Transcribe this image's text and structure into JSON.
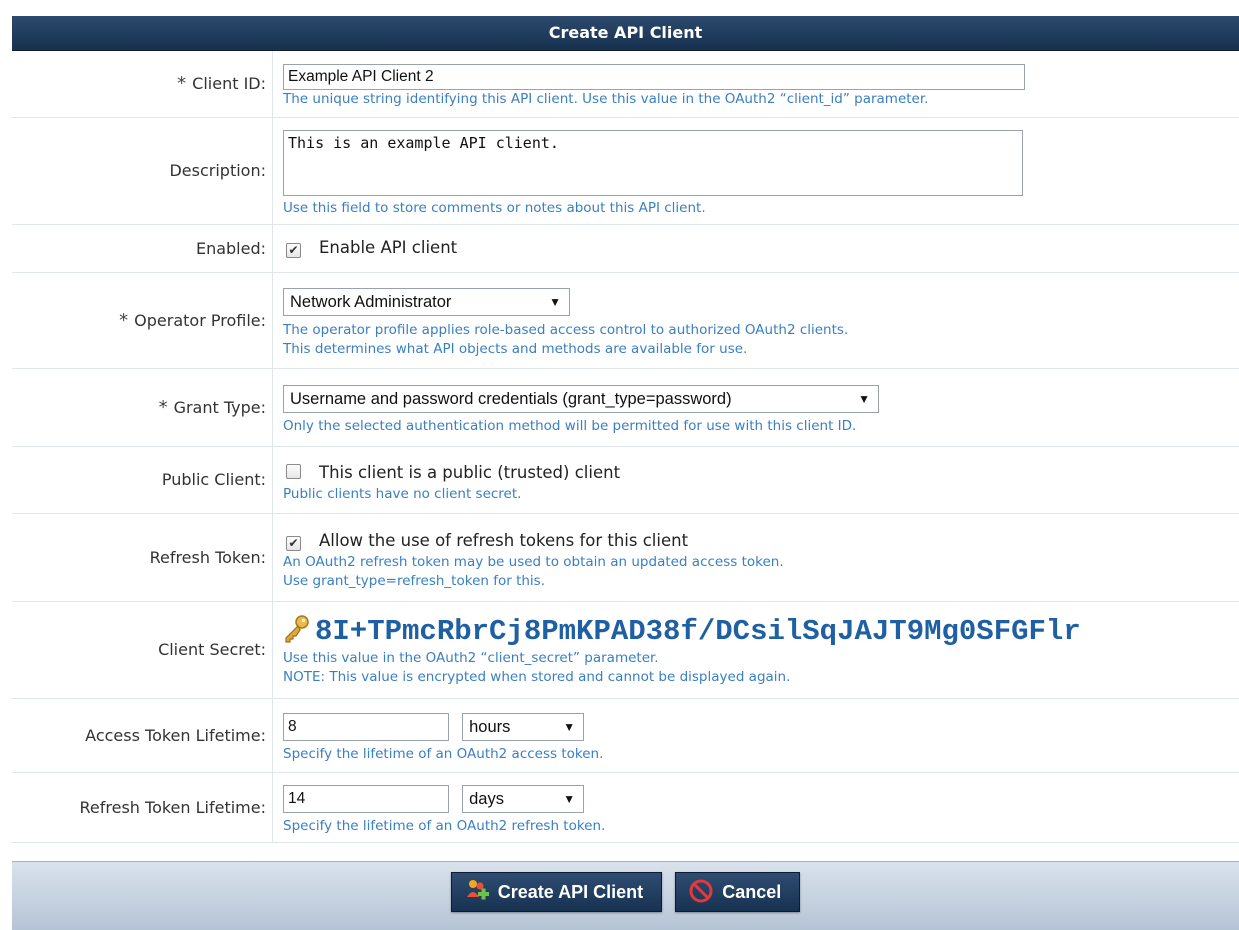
{
  "form": {
    "title": "Create API Client",
    "required_mark": "*",
    "client_id": {
      "label": "Client ID:",
      "value": "Example API Client 2",
      "hint": "The unique string identifying this API client. Use this value in the OAuth2 “client_id” parameter."
    },
    "description": {
      "label": "Description:",
      "value": "This is an example API client.",
      "hint": "Use this field to store comments or notes about this API client."
    },
    "enabled": {
      "label": "Enabled:",
      "checked": true,
      "check_label": "Enable API client"
    },
    "operator_profile": {
      "label": "Operator Profile:",
      "selected": "Network Administrator",
      "hint_line1": "The operator profile applies role-based access control to authorized OAuth2 clients.",
      "hint_line2": "This determines what API objects and methods are available for use."
    },
    "grant_type": {
      "label": "Grant Type:",
      "selected": "Username and password credentials (grant_type=password)",
      "hint": "Only the selected authentication method will be permitted for use with this client ID."
    },
    "public_client": {
      "label": "Public Client:",
      "checked": false,
      "check_label": "This client is a public (trusted) client",
      "hint": "Public clients have no client secret."
    },
    "refresh_token": {
      "label": "Refresh Token:",
      "checked": true,
      "check_label": "Allow the use of refresh tokens for this client",
      "hint_line1": "An OAuth2 refresh token may be used to obtain an updated access token.",
      "hint_line2": "Use grant_type=refresh_token for this."
    },
    "client_secret": {
      "label": "Client Secret:",
      "value": "8I+TPmcRbrCj8PmKPAD38f/DCsilSqJAJT9Mg0SFGFlr",
      "hint_line1": "Use this value in the OAuth2 “client_secret” parameter.",
      "hint_line2": "NOTE: This value is encrypted when stored and cannot be displayed again."
    },
    "access_token_lifetime": {
      "label": "Access Token Lifetime:",
      "value": "8",
      "unit": "hours",
      "hint": "Specify the lifetime of an OAuth2 access token."
    },
    "refresh_token_lifetime": {
      "label": "Refresh Token Lifetime:",
      "value": "14",
      "unit": "days",
      "hint": "Specify the lifetime of an OAuth2 refresh token."
    }
  },
  "buttons": {
    "create_label": "Create API Client",
    "cancel_label": "Cancel"
  },
  "colors": {
    "title_bar": "#17314f",
    "hint_text": "#3a7fc1",
    "secret_text": "#1f5fa3",
    "footer_bar": "#b5c4d5"
  }
}
